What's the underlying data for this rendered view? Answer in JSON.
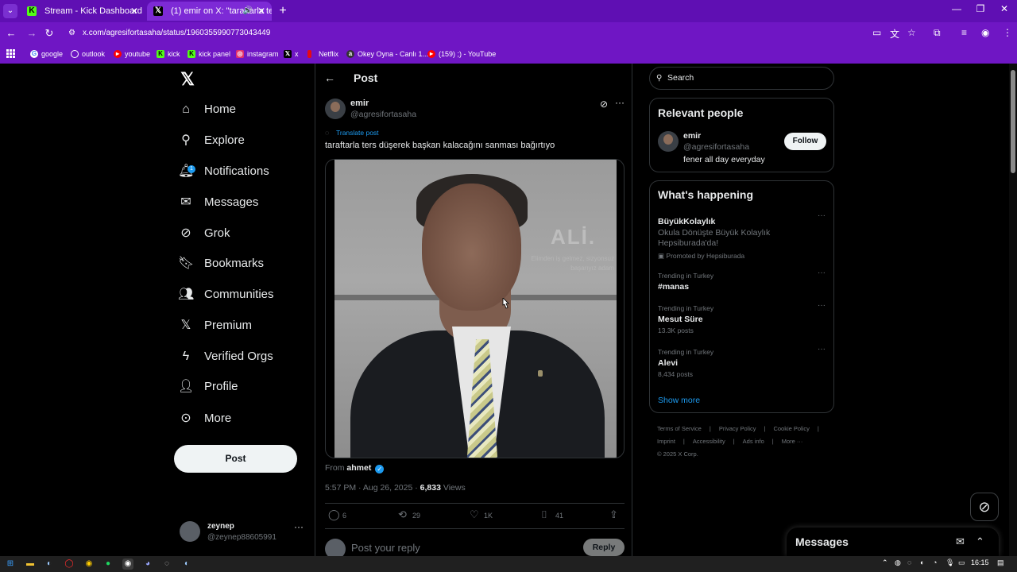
{
  "browser": {
    "tabs": [
      {
        "title": "Stream - Kick Dashboard",
        "favicon": "kick-icon",
        "active": false
      },
      {
        "title": "(1) emir on X: \"taraftarla te",
        "favicon": "x-icon",
        "active": true
      }
    ],
    "url": "x.com/agresifortasaha/status/1960355990773043449",
    "bookmarks": [
      {
        "label": "google",
        "icon": "google-icon"
      },
      {
        "label": "outlook",
        "icon": "outlook-icon"
      },
      {
        "label": "youtube",
        "icon": "youtube-icon"
      },
      {
        "label": "kick",
        "icon": "kick-icon"
      },
      {
        "label": "kick panel",
        "icon": "kick-icon"
      },
      {
        "label": "instagram",
        "icon": "instagram-icon"
      },
      {
        "label": "x",
        "icon": "x-icon"
      },
      {
        "label": "Netflix",
        "icon": "netflix-icon"
      },
      {
        "label": "Okey Oyna - Canlı 1...",
        "icon": "okey-icon"
      },
      {
        "label": "(159) ;) - YouTube",
        "icon": "youtube-icon"
      }
    ],
    "accent": "#6f16c4"
  },
  "nav": {
    "items": [
      {
        "label": "Home",
        "icon": "home-icon"
      },
      {
        "label": "Explore",
        "icon": "search-icon"
      },
      {
        "label": "Notifications",
        "icon": "bell-icon",
        "badge": "1"
      },
      {
        "label": "Messages",
        "icon": "envelope-icon"
      },
      {
        "label": "Grok",
        "icon": "grok-icon"
      },
      {
        "label": "Bookmarks",
        "icon": "bookmark-icon"
      },
      {
        "label": "Communities",
        "icon": "people-icon"
      },
      {
        "label": "Premium",
        "icon": "x-icon"
      },
      {
        "label": "Verified Orgs",
        "icon": "lightning-icon"
      },
      {
        "label": "Profile",
        "icon": "person-icon"
      },
      {
        "label": "More",
        "icon": "more-circle-icon"
      }
    ],
    "post_button": "Post",
    "account": {
      "name": "zeynep",
      "handle": "@zeynep88605991"
    }
  },
  "post": {
    "header_title": "Post",
    "author": {
      "name": "emir",
      "handle": "@agresifortasaha"
    },
    "translate": "Translate post",
    "text": "taraftarla ters düşerek başkan kalacağını sanması bağırtıyo",
    "image_text": {
      "title": "ALİ.",
      "subtitle": "Elimden iş gelmez, sizyonsuz başarıyız adam"
    },
    "from_label": "From",
    "from_name": "ahmet",
    "timestamp": "5:57 PM · Aug 26, 2025 ·",
    "views_count": "6,833",
    "views_label": "Views",
    "actions": {
      "replies": "6",
      "reposts": "29",
      "likes": "1K",
      "bookmarks": "41"
    },
    "reply_placeholder": "Post your reply",
    "reply_button": "Reply"
  },
  "sidebar": {
    "search_placeholder": "Search",
    "relevant": {
      "title": "Relevant people",
      "name": "emir",
      "handle": "@agresifortasaha",
      "bio": "fener all day everyday",
      "follow": "Follow"
    },
    "happening": {
      "title": "What's happening",
      "trends": [
        {
          "title": "BüyükKolaylık",
          "desc": "Okula Dönüşte Büyük Kolaylık Hepsiburada'da!",
          "promo": "Promoted by Hepsiburada"
        },
        {
          "context": "Trending in Turkey",
          "title": "#manas"
        },
        {
          "context": "Trending in Turkey",
          "title": "Mesut Süre",
          "posts": "13.3K posts"
        },
        {
          "context": "Trending in Turkey",
          "title": "Alevi",
          "posts": "8,434 posts"
        }
      ],
      "show_more": "Show more"
    },
    "footer": [
      "Terms of Service",
      "|",
      "Privacy Policy",
      "|",
      "Cookie Policy",
      "|",
      "Imprint",
      "|",
      "Accessibility",
      "|",
      "Ads info",
      "|",
      "More ···",
      "© 2025 X Corp."
    ]
  },
  "messages_drawer": {
    "title": "Messages"
  },
  "taskbar": {
    "time": "16:15"
  }
}
